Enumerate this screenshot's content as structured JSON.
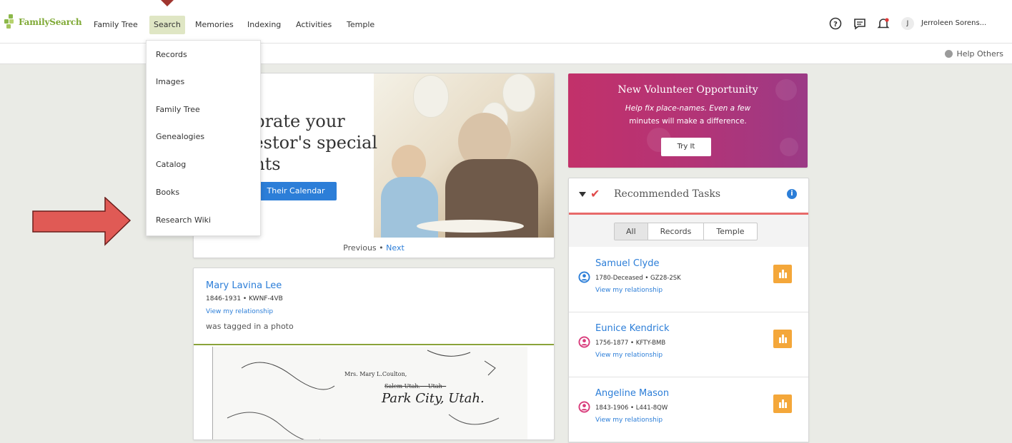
{
  "brand": {
    "logo_text": "FamilySearch",
    "accent": "#7fa935"
  },
  "nav": {
    "items": [
      "Family Tree",
      "Search",
      "Memories",
      "Indexing",
      "Activities",
      "Temple"
    ],
    "active": "Search",
    "icons": [
      "help-icon",
      "messages-icon",
      "notifications-icon"
    ],
    "user_initial": "J",
    "user_name": "Jerroleen Sorens..."
  },
  "subbar": {
    "help_others": "Help Others"
  },
  "search_menu": {
    "items": [
      "Records",
      "Images",
      "Family Tree",
      "Genealogies",
      "Catalog",
      "Books",
      "Research Wiki"
    ]
  },
  "annotation": {
    "arrow_color": "#e05a55",
    "points_to": "Research Wiki"
  },
  "hero": {
    "title": "ebrate your\ncestor's special\nents",
    "button_label": "Their Calendar",
    "pager_prev": "Previous",
    "pager_sep": "•",
    "pager_next": "Next"
  },
  "memory": {
    "name": "Mary Lavina Lee",
    "meta": "1846-1931 • KWNF-4VB",
    "relationship_link": "View my relationship",
    "action": "was tagged in a photo",
    "doc_line1": "Mrs. Mary L.Coulton,",
    "doc_line2": "Salem Utah.----Utah--",
    "doc_line3": "Park City, Utah."
  },
  "volunteer": {
    "title": "New Volunteer Opportunity",
    "line1": "Help fix place-names. Even a few",
    "line2": "minutes will make a difference.",
    "button_label": "Try It"
  },
  "tasks": {
    "title": "Recommended Tasks",
    "tabs": [
      "All",
      "Records",
      "Temple"
    ],
    "active_tab": "All",
    "items": [
      {
        "name": "Samuel Clyde",
        "meta": "1780-Deceased • GZ28-2SK",
        "relationship": "View my relationship",
        "gender": "male",
        "gender_color": "#2c7ed8"
      },
      {
        "name": "Eunice Kendrick",
        "meta": "1756-1877 • KFTY-BMB",
        "relationship": "View my relationship",
        "gender": "female",
        "gender_color": "#d83a7a"
      },
      {
        "name": "Angeline Mason",
        "meta": "1843-1906 • L441-8QW",
        "relationship": "View my relationship",
        "gender": "female",
        "gender_color": "#d83a7a"
      }
    ]
  }
}
